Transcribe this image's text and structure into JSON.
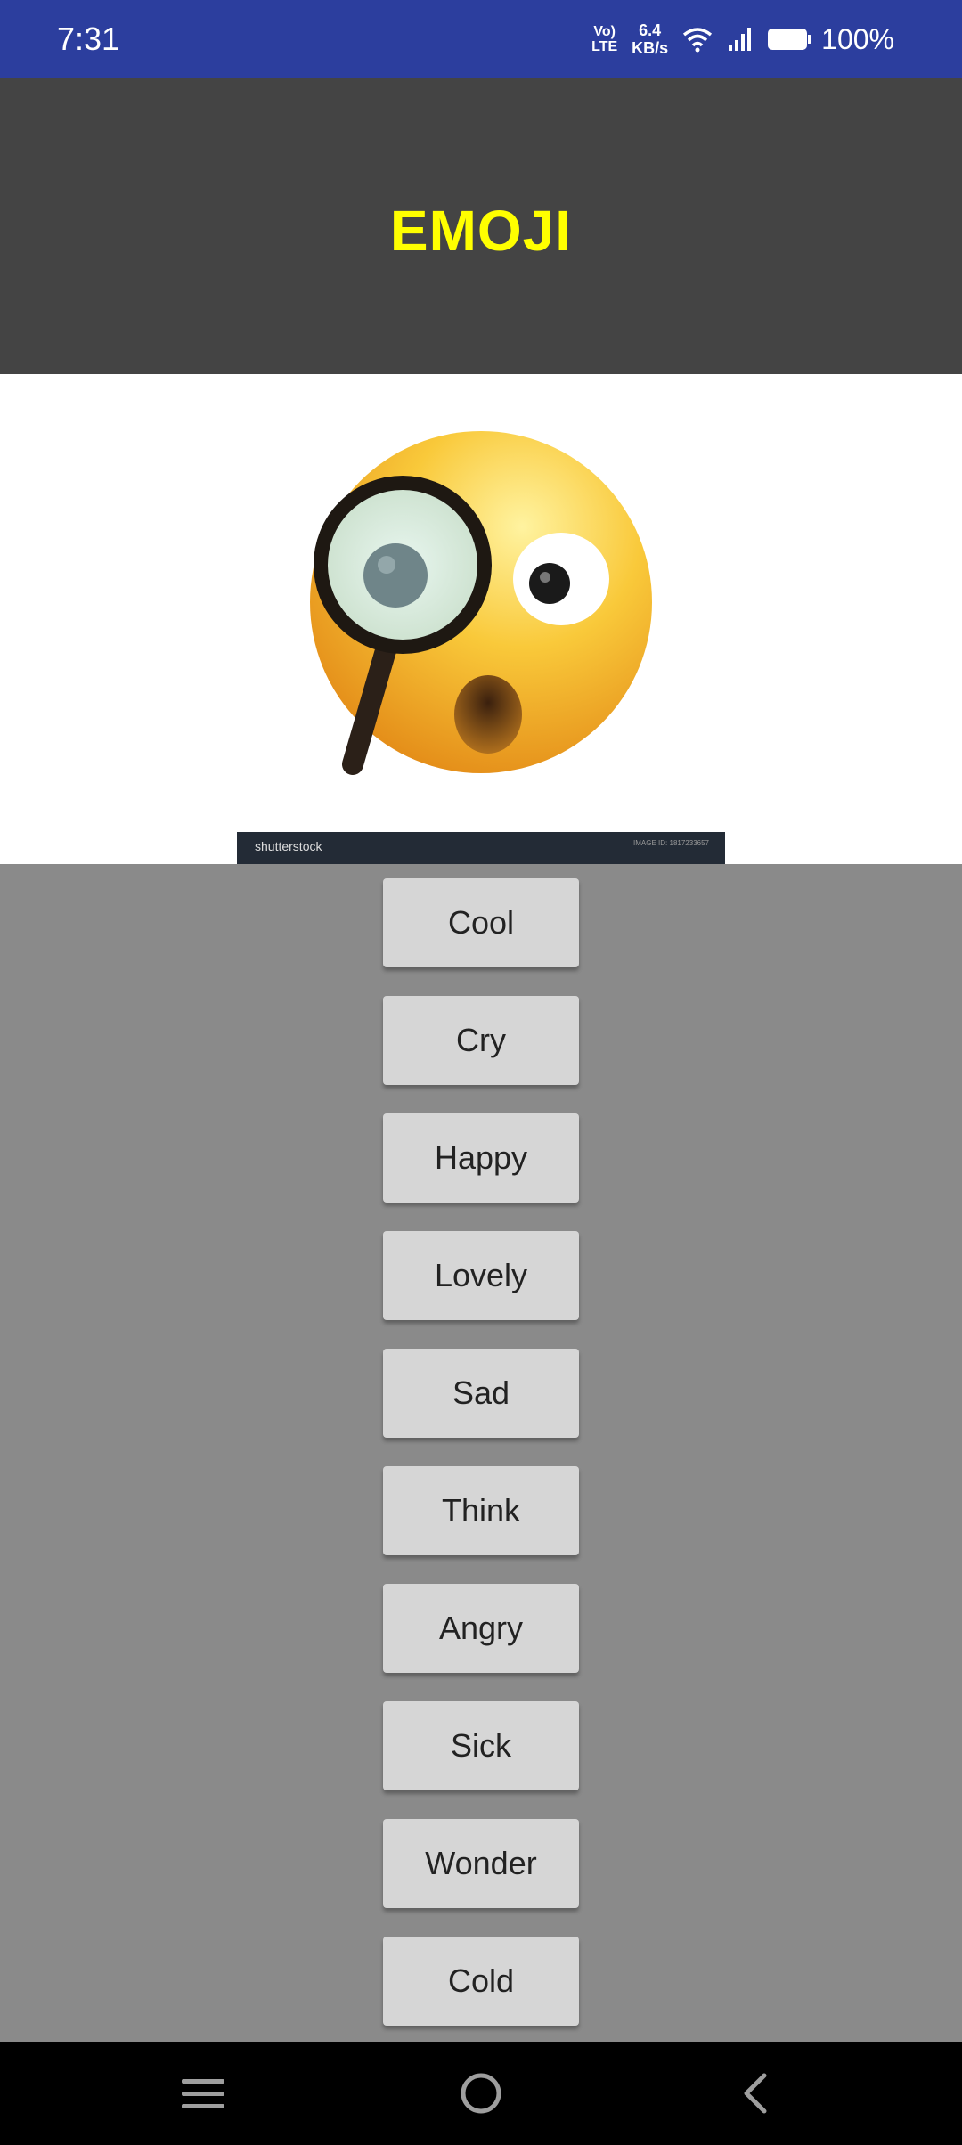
{
  "status_bar": {
    "time": "7:31",
    "volte_top": "Vo)",
    "volte_bottom": "LTE",
    "speed_value": "6.4",
    "speed_unit": "KB/s",
    "battery": "100%"
  },
  "header": {
    "title": "EMOJI",
    "title_color": "#ffff00",
    "background_color": "#444444"
  },
  "image": {
    "icon": "thinking-magnifier-emoji-icon",
    "watermark": "shutterstock",
    "watermark_id": "IMAGE ID: 1817233657"
  },
  "buttons": [
    {
      "label": "Cool"
    },
    {
      "label": "Cry"
    },
    {
      "label": "Happy"
    },
    {
      "label": "Lovely"
    },
    {
      "label": "Sad"
    },
    {
      "label": "Think"
    },
    {
      "label": "Angry"
    },
    {
      "label": "Sick"
    },
    {
      "label": "Wonder"
    },
    {
      "label": "Cold"
    }
  ],
  "nav": {
    "menu_icon": "menu-icon",
    "home_icon": "home-icon",
    "back_icon": "back-icon"
  }
}
